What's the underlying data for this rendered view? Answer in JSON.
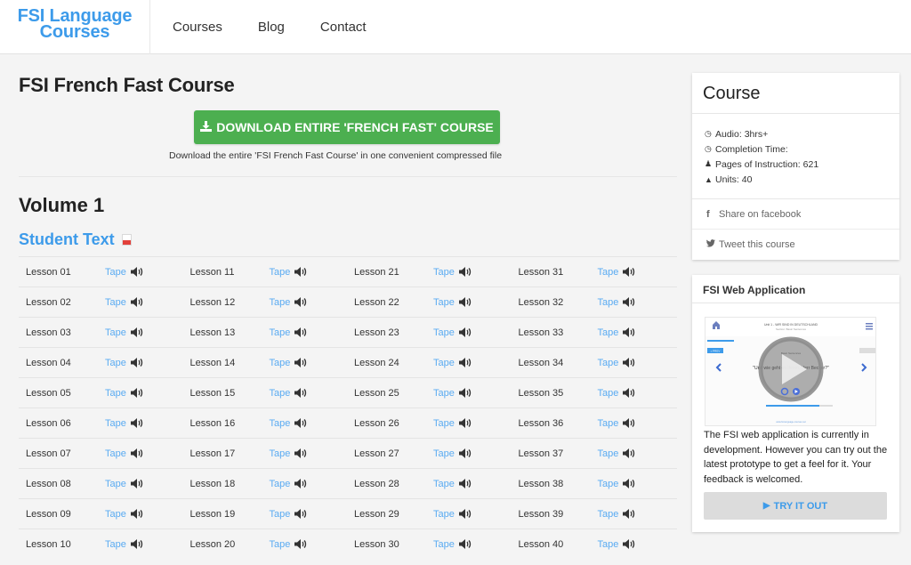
{
  "header": {
    "brand_line1": "FSI Language",
    "brand_line2": "Courses",
    "nav": [
      "Courses",
      "Blog",
      "Contact"
    ]
  },
  "main": {
    "title": "FSI French Fast Course",
    "download_button": "DOWNLOAD ENTIRE 'FRENCH FAST' COURSE",
    "download_icon": "download-icon",
    "download_note": "Download the entire 'FSI French Fast Course' in one convenient compressed file",
    "volume_title": "Volume 1",
    "student_text": "Student Text",
    "student_text_icon": "pdf-icon",
    "tape_label": "Tape",
    "tape_icon": "speaker-icon",
    "lessons": [
      [
        "Lesson 01",
        "Lesson 11",
        "Lesson 21",
        "Lesson 31"
      ],
      [
        "Lesson 02",
        "Lesson 12",
        "Lesson 22",
        "Lesson 32"
      ],
      [
        "Lesson 03",
        "Lesson 13",
        "Lesson 23",
        "Lesson 33"
      ],
      [
        "Lesson 04",
        "Lesson 14",
        "Lesson 24",
        "Lesson 34"
      ],
      [
        "Lesson 05",
        "Lesson 15",
        "Lesson 25",
        "Lesson 35"
      ],
      [
        "Lesson 06",
        "Lesson 16",
        "Lesson 26",
        "Lesson 36"
      ],
      [
        "Lesson 07",
        "Lesson 17",
        "Lesson 27",
        "Lesson 37"
      ],
      [
        "Lesson 08",
        "Lesson 18",
        "Lesson 28",
        "Lesson 38"
      ],
      [
        "Lesson 09",
        "Lesson 19",
        "Lesson 29",
        "Lesson 39"
      ],
      [
        "Lesson 10",
        "Lesson 20",
        "Lesson 30",
        "Lesson 40"
      ]
    ]
  },
  "sidebar": {
    "course_title": "Course",
    "info": [
      {
        "icon": "clock-icon",
        "text": "Audio: 3hrs+"
      },
      {
        "icon": "clock-icon",
        "text": "Completion Time:"
      },
      {
        "icon": "user-icon",
        "text": "Pages of Instruction: 621"
      },
      {
        "icon": "graduation-cap-icon",
        "text": "Units: 40"
      }
    ],
    "share_facebook": "Share on facebook",
    "tweet": "Tweet this course",
    "app_title": "FSI Web Application",
    "app_screenshot": {
      "unit_title": "Unit 1 - WIR SIND IN DEUTSCHLAND",
      "subtitle": "Section: Basic Sentences",
      "prev_label": "« PREV",
      "section_label": "Basic Sentences",
      "sentence": "\"Und wie geht es Ihnen, Herr Becker?\"",
      "footer": "www.fsi-language-courses.net"
    },
    "app_description": "The FSI web application is currently in development. However you can try out the latest prototype to get a feel for it. Your feedback is welcomed.",
    "try_button": "TRY IT OUT",
    "colors": {
      "accent": "#3d9bea",
      "download_green": "#4caf50",
      "tape_link": "#5aabf2"
    }
  }
}
